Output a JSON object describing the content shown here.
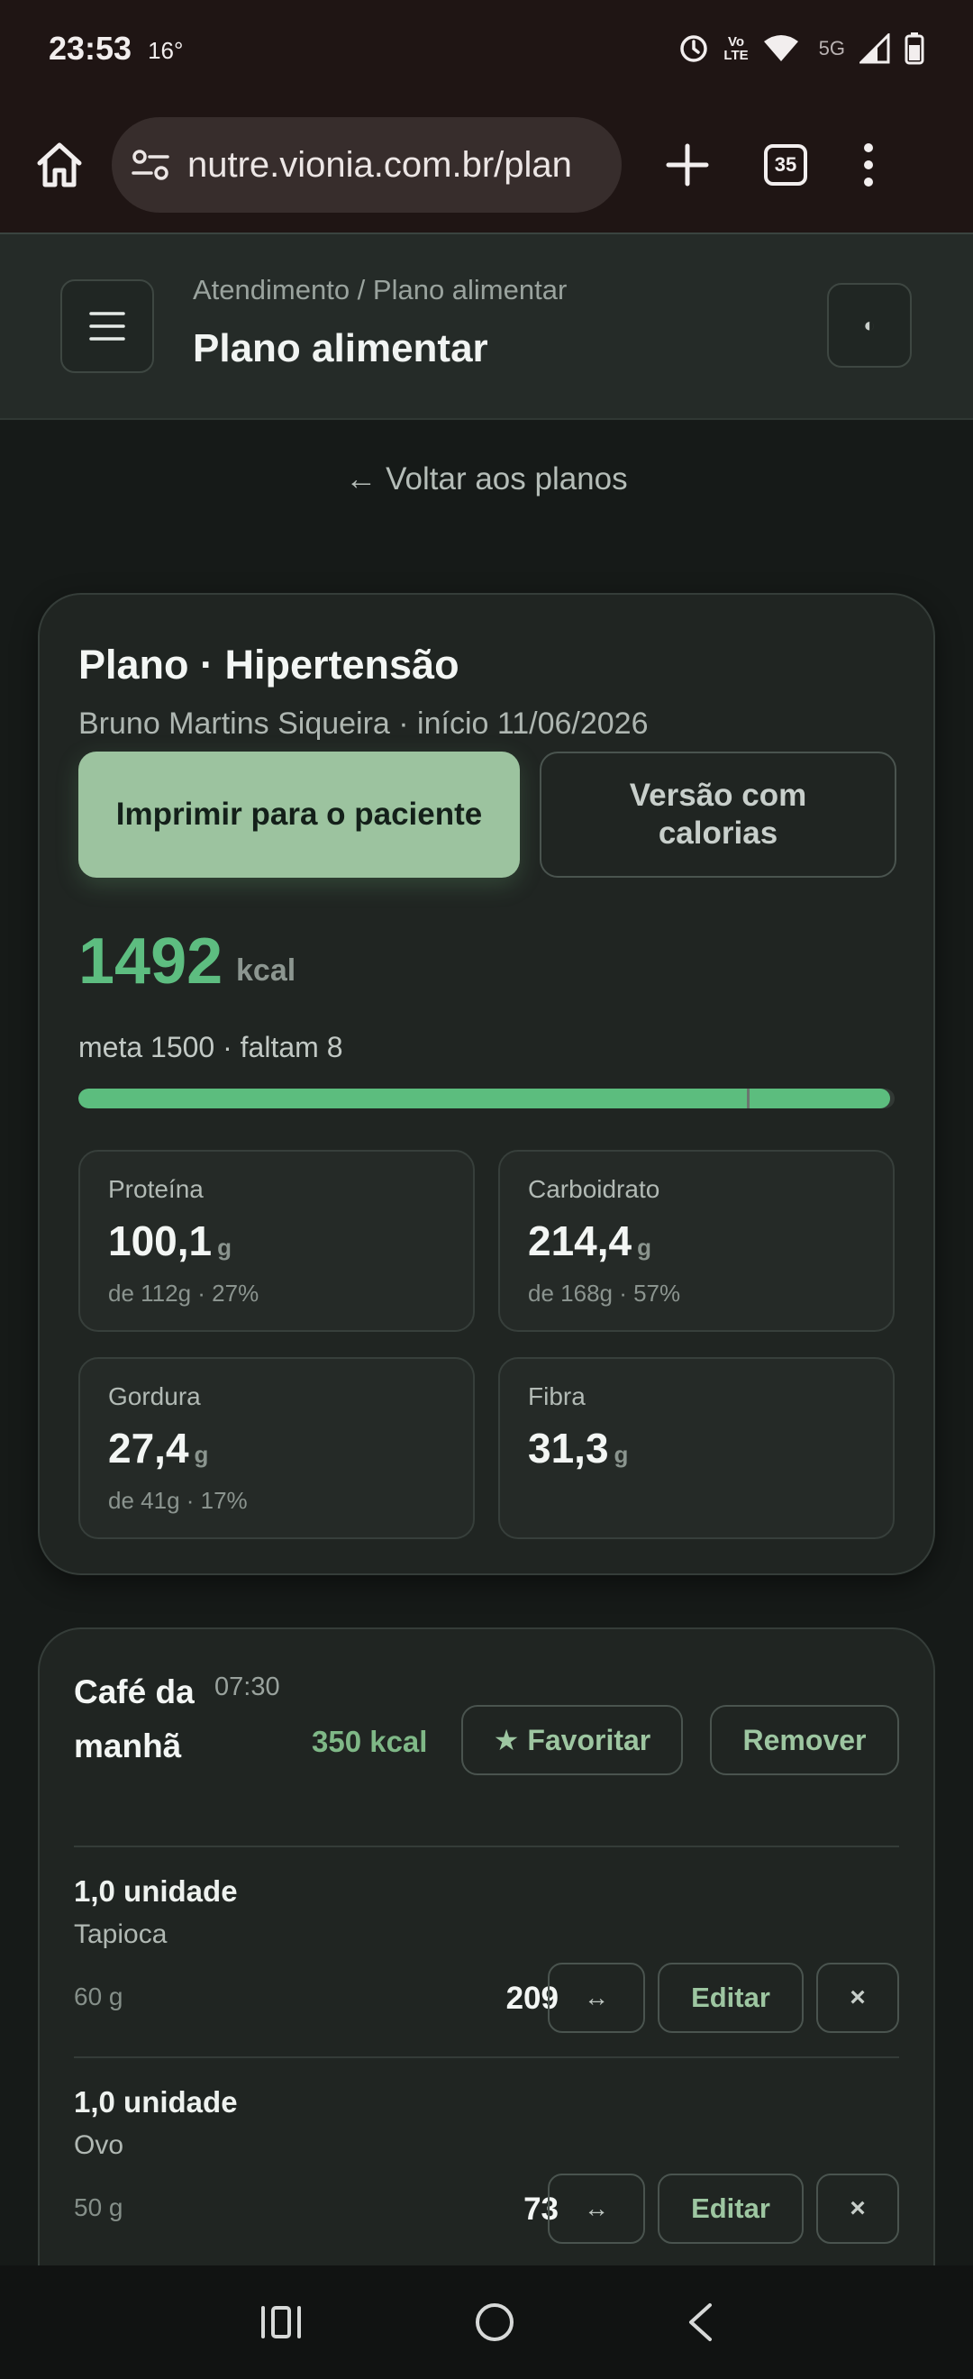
{
  "status_bar": {
    "time": "23:53",
    "temp": "16°",
    "volte": "Vo LTE",
    "network": "5G"
  },
  "browser": {
    "url": "nutre.vionia.com.br/plan",
    "tab_count": "35"
  },
  "header": {
    "breadcrumb": "Atendimento / Plano alimentar",
    "title": "Plano alimentar",
    "theme_icon": "◐"
  },
  "back_link": "← Voltar aos planos",
  "plan": {
    "title": "Plano · Hipertensão",
    "subtitle": "Bruno Martins Siqueira · início 11/06/2026",
    "print_label": "Imprimir para o paciente",
    "calories_label": "Versão com calorias",
    "kcal_value": "1492",
    "kcal_unit": "kcal",
    "goal_text": "meta 1500 · faltam 8",
    "progress_fraction": 0.995,
    "macros": [
      {
        "label": "Proteína",
        "value": "100,1",
        "unit": "g",
        "sub": "de 112g · 27%"
      },
      {
        "label": "Carboidrato",
        "value": "214,4",
        "unit": "g",
        "sub": "de 168g · 57%"
      },
      {
        "label": "Gordura",
        "value": "27,4",
        "unit": "g",
        "sub": "de 41g · 17%"
      },
      {
        "label": "Fibra",
        "value": "31,3",
        "unit": "g",
        "sub": ""
      }
    ]
  },
  "meal": {
    "name": "Café da manhã",
    "time": "07:30",
    "kcal": "350 kcal",
    "favorite_label": "★ Favoritar",
    "remove_label": "Remover",
    "items": [
      {
        "qty": "1,0 unidade",
        "food": "Tapioca",
        "weight": "60 g",
        "kcal": "209",
        "swap": "↔",
        "edit": "Editar",
        "delete": "×"
      },
      {
        "qty": "1,0 unidade",
        "food": "Ovo",
        "weight": "50 g",
        "kcal": "73",
        "swap": "↔",
        "edit": "Editar",
        "delete": "×"
      }
    ]
  },
  "colors": {
    "accent": "#5cbd7e",
    "primary_button": "#9cc39f",
    "background": "#161a18",
    "card": "#202522"
  }
}
